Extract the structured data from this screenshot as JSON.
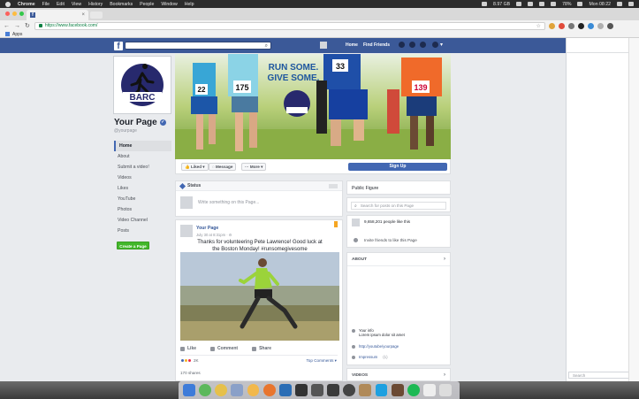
{
  "menubar": {
    "app": "Chrome",
    "items": [
      "File",
      "Edit",
      "View",
      "History",
      "Bookmarks",
      "People",
      "Window",
      "Help"
    ],
    "memory": "8.97 GB",
    "battery": "78%",
    "clock": "Mon 08:22"
  },
  "browser": {
    "url": "https://www.facebook.com/",
    "bookmarks_label": "Apps"
  },
  "fb_nav": {
    "home": "Home",
    "find_friends": "Find Friends"
  },
  "page": {
    "name": "Your Page",
    "handle": "@yourpage",
    "logo_text": "BARC",
    "nav": [
      "Home",
      "About",
      "Submit a video!",
      "Videos",
      "Likes",
      "YouTube",
      "Photos",
      "Video Channel",
      "Posts"
    ],
    "create_page": "Create a Page"
  },
  "cover": {
    "slogan_line1": "RUN SOME.",
    "slogan_line2": "GIVE SOME.",
    "bibs": [
      "22",
      "175",
      "33",
      "139"
    ]
  },
  "actions": {
    "liked": "Liked",
    "message": "Message",
    "more": "More",
    "signup": "Sign Up"
  },
  "composer": {
    "tab": "Status",
    "placeholder": "Write something on this Page..."
  },
  "post": {
    "author": "Your Page",
    "meta": "July 30 at 8:31pm · ⚙",
    "text": "Thanks for volunteering Pete Lawrence!  Good luck at the Boston Monday!  #runsomegivesome",
    "like": "Like",
    "comment": "Comment",
    "share": "Share",
    "reactions": "2K",
    "top_comments": "Top Comments",
    "shares": "170 shares"
  },
  "sidebar": {
    "category": "Public Figure",
    "search_placeholder": "Search for posts on this Page",
    "likes": "9,658,201 people like this",
    "invite": "Invite friends to like this Page",
    "about": "ABOUT",
    "info_label": "Your info",
    "info_text": "Lorem ipsum dolor sit amet",
    "website": "http://youtube/yourpage",
    "impressum": "Impressum",
    "impressum_count": "(1)",
    "videos": "VIDEOS"
  },
  "chat": {
    "search_placeholder": "Search"
  },
  "colors": {
    "fb_blue": "#3b5998",
    "button_blue": "#4267b2",
    "green": "#42b72a"
  }
}
